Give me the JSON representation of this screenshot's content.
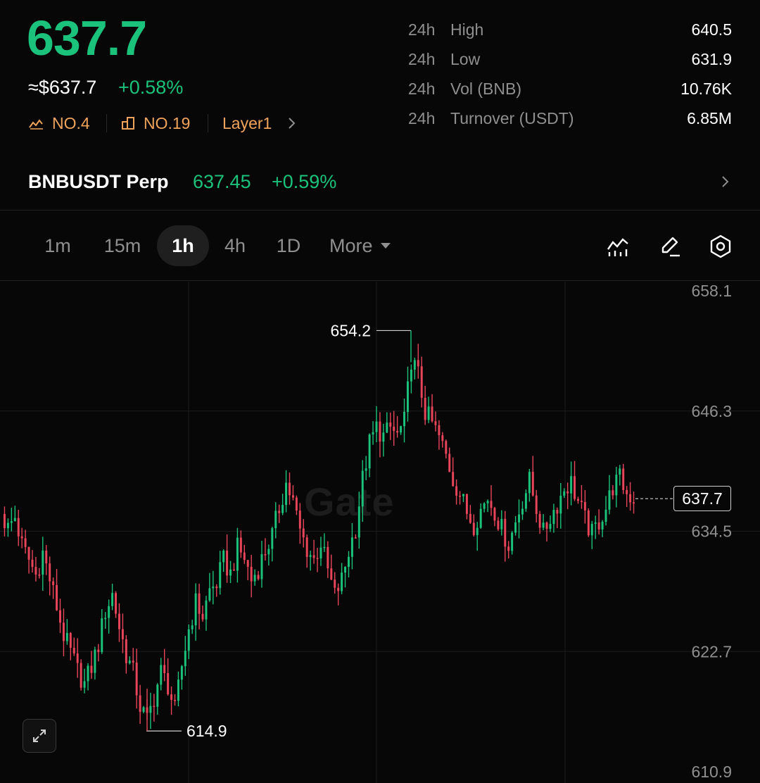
{
  "header": {
    "last_price": "637.7",
    "usd_price": "≈$637.7",
    "change_pct": "+0.58%",
    "rank_market_cap": "NO.4",
    "rank_volume": "NO.19",
    "category": "Layer1"
  },
  "stats": [
    {
      "period": "24h",
      "label": "High",
      "value": "640.5"
    },
    {
      "period": "24h",
      "label": "Low",
      "value": "631.9"
    },
    {
      "period": "24h",
      "label": "Vol (BNB)",
      "value": "10.76K"
    },
    {
      "period": "24h",
      "label": "Turnover (USDT)",
      "value": "6.85M"
    }
  ],
  "perp": {
    "name": "BNBUSDT Perp",
    "price": "637.45",
    "change_pct": "+0.59%"
  },
  "timeframes": [
    {
      "label": "1m",
      "active": false
    },
    {
      "label": "15m",
      "active": false
    },
    {
      "label": "1h",
      "active": true
    },
    {
      "label": "4h",
      "active": false
    },
    {
      "label": "1D",
      "active": false
    }
  ],
  "more_label": "More",
  "colors": {
    "up": "#1bc27b",
    "down": "#e8445a",
    "accent_orange": "#f0a35a",
    "background": "#070707"
  },
  "icons": [
    "chart-indicator-icon",
    "draw-pen-icon",
    "settings-hex-icon",
    "expand-icon",
    "chevron-right-icon",
    "caret-down-icon"
  ],
  "watermark": "Gate",
  "chart_data": {
    "type": "candlestick",
    "interval": "1h",
    "y_axis_ticks": [
      "658.1",
      "646.3",
      "634.5",
      "622.7",
      "610.9"
    ],
    "ylim": [
      610.9,
      658.1
    ],
    "current_price": "637.7",
    "max_label": "654.2",
    "min_label": "614.9",
    "close_path": [
      636.2,
      634.8,
      635.9,
      633.1,
      631.7,
      630.2,
      632.4,
      629.8,
      627.1,
      624.3,
      622.6,
      620.8,
      619.5,
      621.2,
      623.4,
      626.7,
      628.3,
      625.1,
      622.4,
      620.6,
      617.3,
      615.9,
      618.2,
      620.7,
      619.4,
      616.8,
      621.3,
      624.9,
      627.5,
      626.2,
      628.7,
      629.4,
      631.6,
      630.3,
      632.8,
      631.9,
      629.7,
      630.9,
      632.6,
      634.1,
      636.8,
      639.2,
      637.4,
      634.5,
      632.8,
      631.7,
      633.4,
      630.6,
      628.2,
      629.7,
      632.5,
      634.9,
      639.6,
      643.1,
      644.7,
      643.8,
      644.6,
      643.9,
      645.2,
      651.4,
      649.8,
      646.2,
      645.1,
      643.7,
      641.9,
      639.6,
      638.2,
      636.4,
      635.2,
      636.6,
      637.8,
      636.5,
      634.7,
      633.2,
      635.4,
      637.6,
      639.4,
      636.8,
      634.3,
      635.9,
      637.2,
      638.7,
      639.3,
      637.4,
      635.6,
      634.2,
      635.5,
      636.8,
      638.9,
      639.7,
      638.2,
      637.7
    ]
  }
}
